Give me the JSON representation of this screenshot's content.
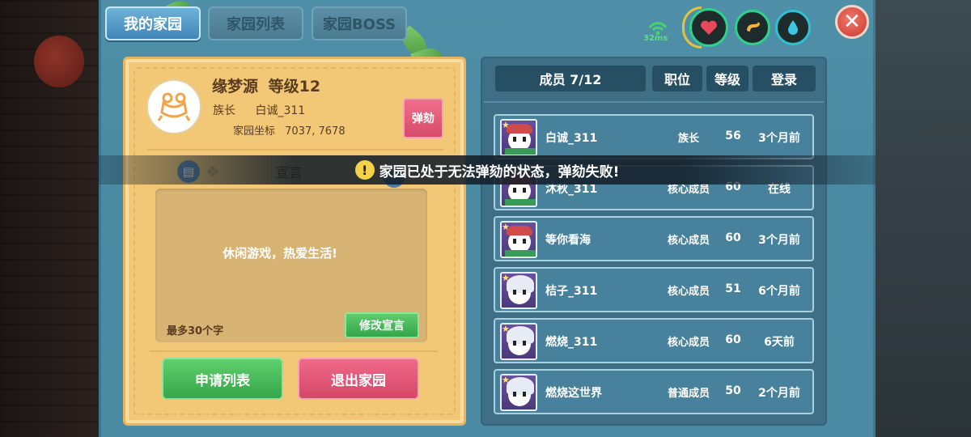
{
  "tabs": [
    {
      "label": "我的家园",
      "active": true
    },
    {
      "label": "家园列表",
      "active": false
    },
    {
      "label": "家园BOSS",
      "active": false
    }
  ],
  "status": {
    "ping": "32ms",
    "ping_color": "#47d36b",
    "icons": [
      "signal-icon",
      "heart-icon",
      "stomach-icon",
      "water-drop-icon"
    ]
  },
  "home": {
    "name": "缘梦源",
    "level": "等级12",
    "leader_label": "族长",
    "leader_name": "白诚_311",
    "coords_label": "家园坐标",
    "coords_value": "7037, 7678",
    "impeach_label": "弹劾",
    "notice_title": "宣言",
    "notice_text": "休闲游戏，热爱生活!",
    "notice_limit": "最多30个字",
    "edit_notice_label": "修改宣言",
    "apply_list_label": "申请列表",
    "quit_label": "退出家园"
  },
  "members_panel": {
    "count_label": "成员 7/12",
    "col_role": "职位",
    "col_level": "等级",
    "col_login": "登录",
    "members": [
      {
        "name": "白诚_311",
        "role": "族长",
        "level": "56",
        "login": "3个月前",
        "avatar": "snowman"
      },
      {
        "name": "沐秋_311",
        "role": "核心成员",
        "level": "60",
        "login": "在线",
        "avatar": "snowman"
      },
      {
        "name": "等你看海",
        "role": "核心成员",
        "level": "60",
        "login": "3个月前",
        "avatar": "snowman"
      },
      {
        "name": "桔子_311",
        "role": "核心成员",
        "level": "51",
        "login": "6个月前",
        "avatar": "white-hair"
      },
      {
        "name": "燃烧_311",
        "role": "核心成员",
        "level": "60",
        "login": "6天前",
        "avatar": "white-hair"
      },
      {
        "name": "燃烧这世界",
        "role": "普通成员",
        "level": "50",
        "login": "2个月前",
        "avatar": "white-hair"
      }
    ]
  },
  "toast": {
    "text": "家园已处于无法弹劾的状态，弹劾失败!"
  },
  "colors": {
    "panel_blue": "#4a8aa3",
    "card_gold": "#f2c876",
    "green_button": "#35a649",
    "pink_button": "#d44666"
  }
}
